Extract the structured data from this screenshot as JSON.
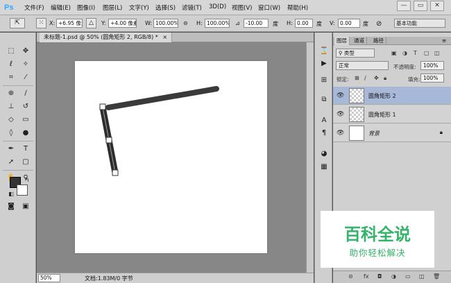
{
  "app": {
    "logo": "Ps"
  },
  "menu": [
    "文件(F)",
    "编辑(E)",
    "图像(I)",
    "图层(L)",
    "文字(Y)",
    "选择(S)",
    "滤镜(T)",
    "3D(D)",
    "视图(V)",
    "窗口(W)",
    "帮助(H)"
  ],
  "window_controls": {
    "minimize": "—",
    "restore": "▭",
    "close": "✕"
  },
  "options_bar": {
    "x_label": "X:",
    "x_value": "+6.95 像素",
    "y_label": "Y:",
    "y_value": "+4.00 像素",
    "w_label": "W:",
    "w_value": "100.00%",
    "h_label": "H:",
    "h_value": "100.00%",
    "angle_value": "-10.00",
    "angle_unit": "度",
    "hskew_label": "H:",
    "hskew_value": "0.00",
    "hskew_unit": "度",
    "vskew_label": "V:",
    "vskew_value": "0.00",
    "vskew_unit": "度",
    "workspace": "基本功能"
  },
  "document": {
    "tab_title": "未标题-1.psd @ 50% (圆角矩形 2, RGB/8) *",
    "close_icon": "×",
    "zoom": "50%",
    "info": "文档:1.83M/0 字节"
  },
  "layers_panel": {
    "tabs": [
      "图层",
      "通道",
      "路径"
    ],
    "filter_kind": "类型",
    "blend_mode": "正常",
    "opacity_label": "不透明度:",
    "opacity_value": "100%",
    "lock_label": "锁定:",
    "fill_label": "填充:",
    "fill_value": "100%",
    "layers": [
      {
        "name": "圆角矩形 2",
        "selected": true
      },
      {
        "name": "圆角矩形 1",
        "selected": false
      },
      {
        "name": "背景",
        "selected": false,
        "locked": true
      }
    ]
  },
  "watermark": {
    "title": "百科全说",
    "subtitle": "助你轻松解决"
  }
}
